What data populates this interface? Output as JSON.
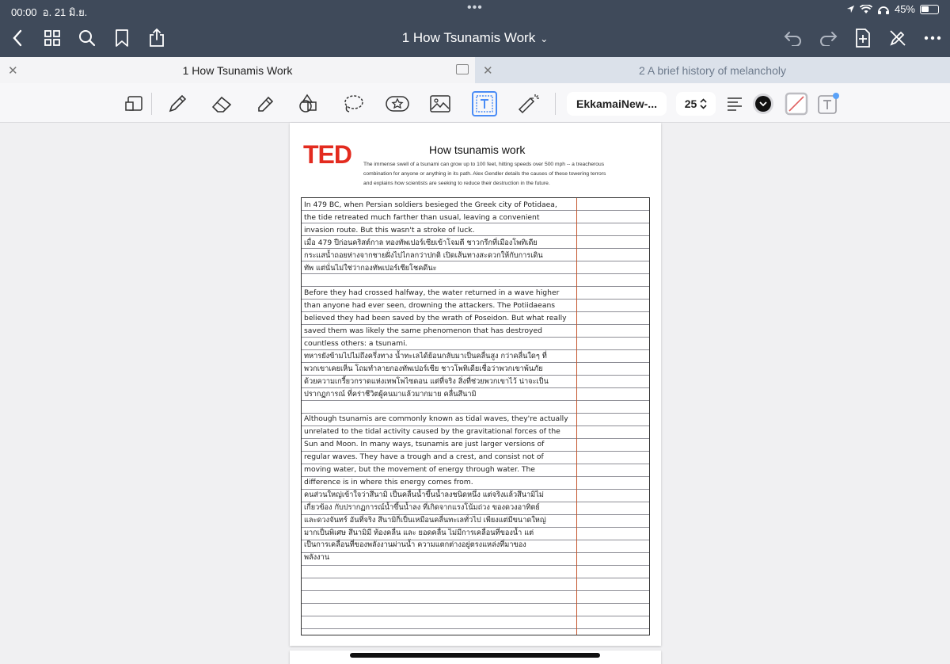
{
  "status": {
    "time": "00:00",
    "date": "อ. 21 มิ.ย.",
    "battery": "45%"
  },
  "nav": {
    "title": "1 How Tsunamis Work"
  },
  "tabs": [
    {
      "label": "1 How Tsunamis Work"
    },
    {
      "label": "2 A brief history of melancholy"
    }
  ],
  "toolbar": {
    "font_name": "EkkamaiNew-...",
    "font_size": "25"
  },
  "document": {
    "logo": "TED",
    "title": "How tsunamis work",
    "description_lines": [
      "The immense swell of a tsunami can grow up to 100 feet, hitting speeds over 500 mph -- a treacherous",
      "combination for anyone or anything in its path. Alex Gendler details the causes of these towering terrors",
      "and explains how scientists are seeking to reduce their destruction in the future."
    ],
    "notes": [
      "In 479 BC, when Persian soldiers besieged the Greek city of Potidaea,",
      "the tide retreated much farther than usual, leaving a convenient",
      "invasion route. But this wasn't a stroke of luck.",
      "เมื่อ 479 ปีก่อนคริสต์กาล ทองทัพเปอร์เซียเข้าโจมตี ชาวกรีกที่เมืองโพทิเดีย",
      "กระแสน้ำถอยห่างจากชายฝั่งไปไกลกว่าปกติ เปิดเส้นทางสะดวกให้กับการเดิน",
      "ทัพ แต่นั่นไม่ใช่ว่ากองทัพเปอร์เซียโชคดีนะ",
      "",
      "Before they had crossed halfway, the water returned in a wave higher",
      "than anyone had ever seen, drowning the attackers. The Potiidaeans",
      "believed they had been saved by the wrath of Poseidon. But what really",
      "saved them was likely the same phenomenon that has destroyed",
      "countless others: a tsunami.",
      "ทหารยังข้ามไปไม่ถึงครึ่งทาง น้ำทะเลได้ย้อนกลับมาเป็นคลื่นสูง กว่าคลื่นใดๆ ที่",
      "พวกเขาเคยเห็น โถมทำลายกองทัพเปอร์เซีย ชาวโพทิเดียเชื่อว่าพวกเขาพ้นภัย",
      "ด้วยความเกรี้ยวกราดแห่งเทพโพไซดอน แต่ที่จริง สิ่งที่ช่วยพวกเขาไว้ น่าจะเป็น",
      "ปรากฏการณ์ ที่คร่าชีวิตผู้คนมาแล้วมากมาย คลื่นสึนามิ",
      "",
      "Although tsunamis are commonly known as tidal waves, they're actually",
      "unrelated to the tidal activity caused by the gravitational forces of the",
      "Sun and Moon. In many ways, tsunamis are just larger versions of",
      "regular waves. They have a trough and a crest, and consist not of",
      "moving water, but the movement of energy through water. The",
      "difference is in where this energy comes from.",
      "คนส่วนใหญ่เข้าใจว่าสึนามิ เป็นคลื่นน้ำขึ้นน้ำลงชนิดหนึ่ง แต่จริงแล้วสึนามิไม่",
      "เกี่ยวข้อง กับปรากฏการณ์น้ำขึ้นน้ำลง ที่เกิดจากแรงโน้มถ่วง ของดวงอาทิตย์",
      "และดวงจันทร์ อันที่จริง สึนามิก็เป็นเหมือนคลื่นทะเลทั่วไป เพียงแต่มีขนาดใหญ่",
      "มากเป็นพิเศษ สึนามิมี ท้องคลื่น และ ยอดคลื่น ไม่มีการเคลื่อนที่ของน้ำ แต่",
      "เป็นการเคลื่อนที่ของพลังงานผ่านน้ำ ความแตกต่างอยู่ตรงแหล่งที่มาของ",
      "พลังงาน"
    ]
  },
  "colors": {
    "bar": "#3f4a5a",
    "accent": "#4a8cf6",
    "ted": "#e32b1f",
    "margin": "#c4552d"
  }
}
